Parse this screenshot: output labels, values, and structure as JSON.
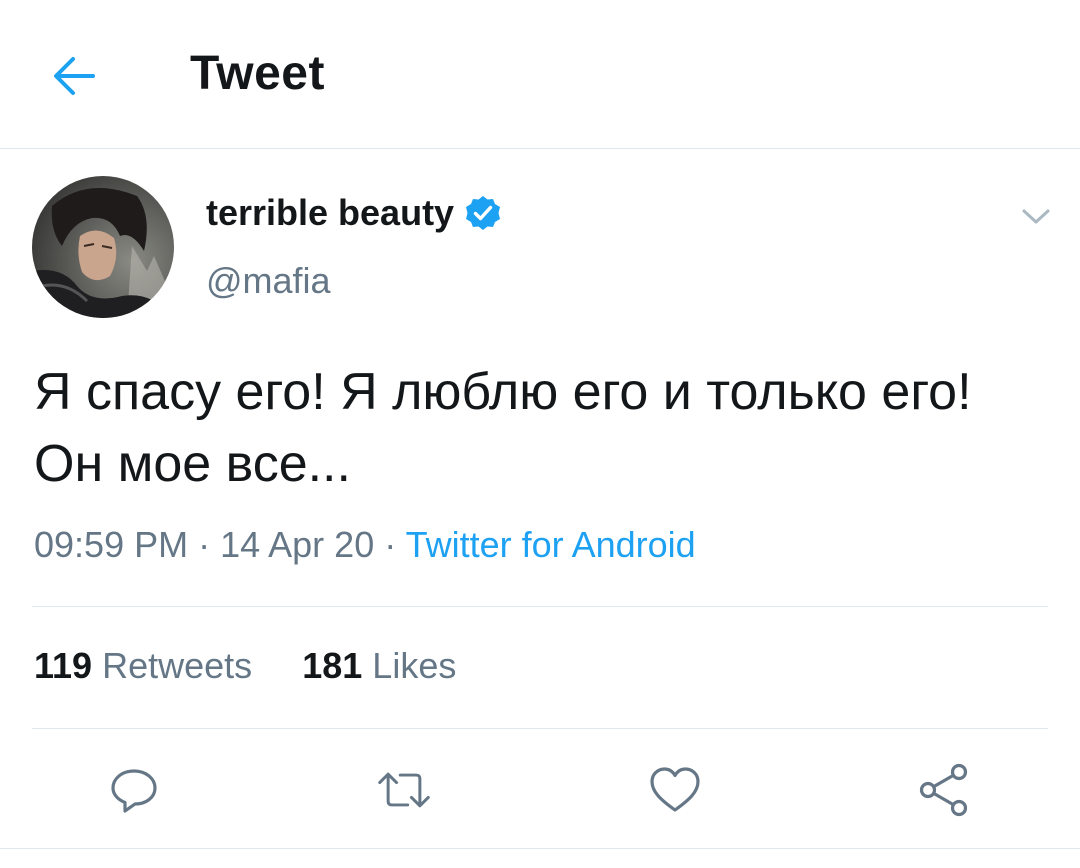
{
  "header": {
    "title": "Tweet",
    "back_icon": "arrow-left-icon"
  },
  "tweet": {
    "author": {
      "name": "terrible beauty",
      "handle": "@mafia",
      "verified": true,
      "verified_icon": "verified-badge-icon",
      "avatar": "avatar-photo"
    },
    "text": "Я спасу его! Я люблю его и только его! Он мое все...",
    "time": "09:59 PM",
    "date": "14 Apr 20",
    "source": "Twitter for Android",
    "separator": " · ",
    "stats": {
      "retweets_count": "119",
      "retweets_label": "Retweets",
      "likes_count": "181",
      "likes_label": "Likes"
    }
  },
  "actions": [
    "reply-icon",
    "retweet-icon",
    "like-icon",
    "share-icon"
  ],
  "colors": {
    "accent": "#1da1f2",
    "secondary_text": "#657786",
    "primary_text": "#14171a",
    "divider": "#e1e8ed"
  }
}
